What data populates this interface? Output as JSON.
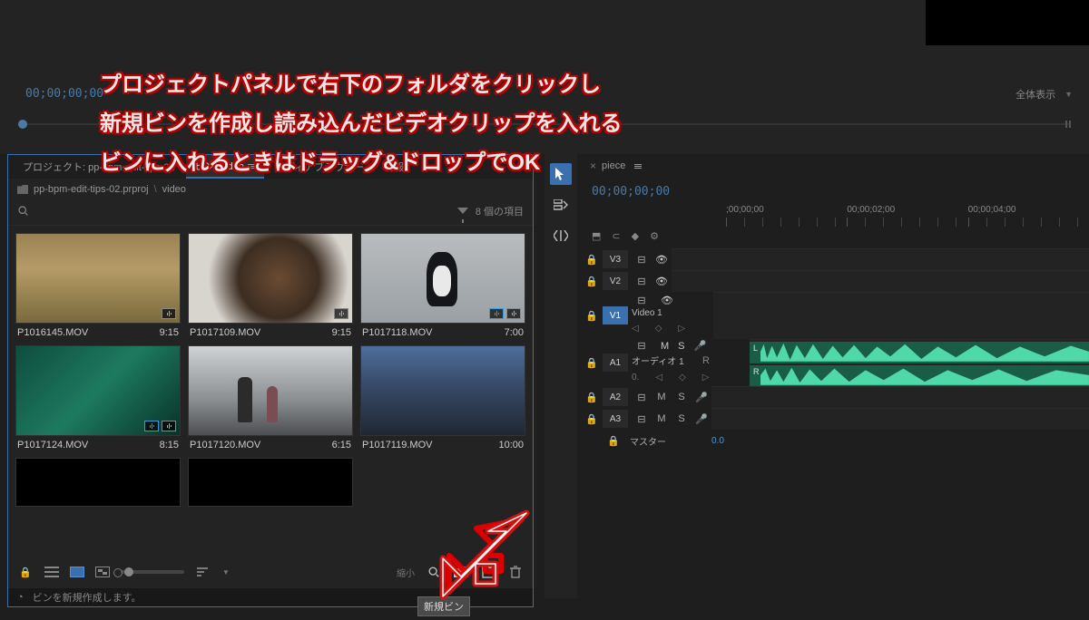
{
  "program": {
    "timecode": "00;00;00;00",
    "fit_label": "全体表示"
  },
  "overlay": {
    "line1": "プロジェクトパネルで右下のフォルダをクリックし",
    "line2": "新規ビンを作成し読み込んだビデオクリップを入れる",
    "line3": "ビンに入れるときはドラッグ&ドロップでOK"
  },
  "project_panel": {
    "tabs": {
      "project": "プロジェクト: pp-bpm-edit-tips-02",
      "bin": "ビン: video",
      "media_browser": "メディアブラウザー",
      "info": "情報"
    },
    "breadcrumb": {
      "proj": "pp-bpm-edit-tips-02.prproj",
      "bin": "video"
    },
    "item_count": "8 個の項目",
    "clips": [
      {
        "name": "P1016145.MOV",
        "dur": "9:15"
      },
      {
        "name": "P1017109.MOV",
        "dur": "9:15"
      },
      {
        "name": "P1017118.MOV",
        "dur": "7:00"
      },
      {
        "name": "P1017124.MOV",
        "dur": "8:15"
      },
      {
        "name": "P1017120.MOV",
        "dur": "6:15"
      },
      {
        "name": "P1017119.MOV",
        "dur": "10:00"
      }
    ],
    "bottom": {
      "res_hint": "縮小"
    }
  },
  "tooltip": "新規ビン",
  "status": "ビンを新規作成します。",
  "timeline": {
    "seq_name": "piece",
    "timecode": "00;00;00;00",
    "ruler": {
      "t0": ";00;00;00",
      "t1": "00;00;02;00",
      "t2": "00;00;04;00"
    },
    "video_tracks": [
      {
        "id": "V3",
        "on": false
      },
      {
        "id": "V2",
        "on": false
      },
      {
        "id": "V1",
        "on": true,
        "name": "Video 1"
      }
    ],
    "audio_tracks": [
      {
        "id": "A1",
        "on": false,
        "name": "オーディオ 1"
      },
      {
        "id": "A2",
        "on": false
      },
      {
        "id": "A3",
        "on": false
      }
    ],
    "master": {
      "label": "マスター",
      "val": "0.0"
    },
    "mute": "M",
    "solo": "S",
    "rec": "R"
  }
}
